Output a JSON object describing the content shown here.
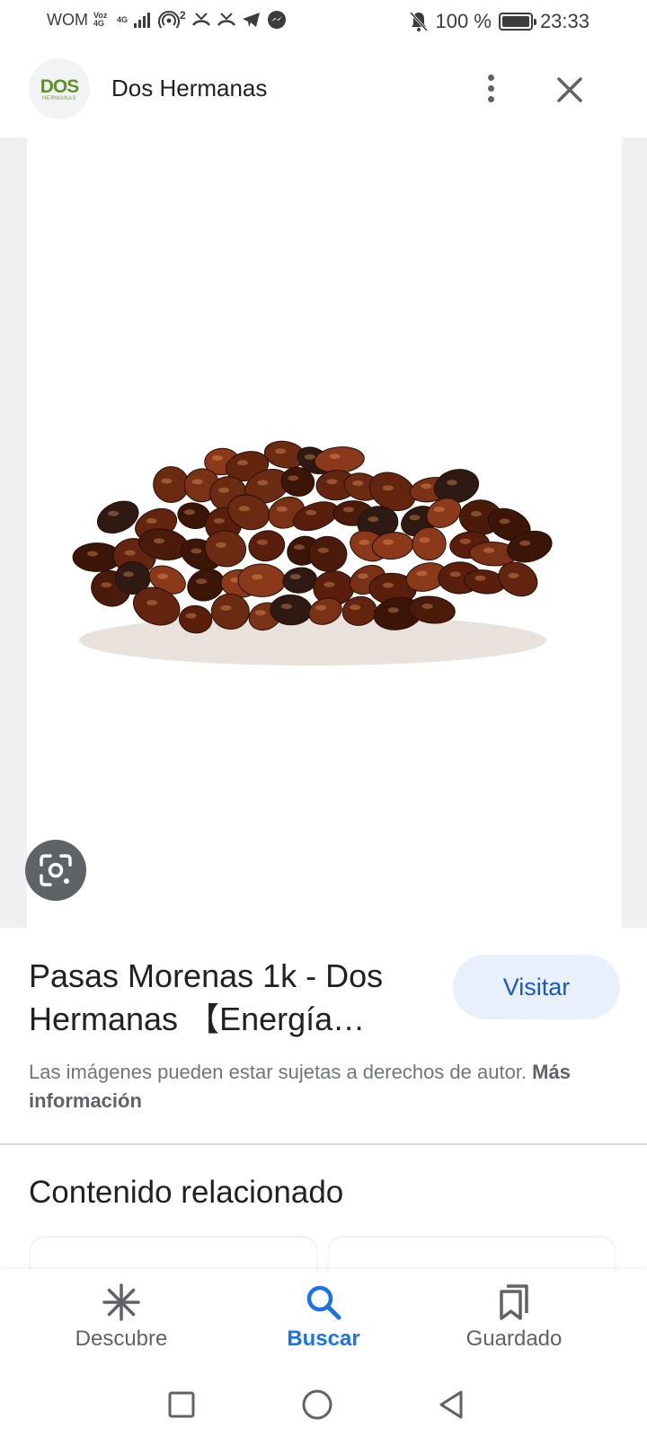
{
  "status_bar": {
    "carrier": "WOM",
    "volte": "Voz 4G",
    "network": "4G",
    "hotspot_count": "2",
    "battery_text": "100 %",
    "battery_level": 1.0,
    "time": "23:33"
  },
  "header": {
    "logo_text": "DOS",
    "logo_subtext": "HERMANAS",
    "site_name": "Dos Hermanas"
  },
  "result": {
    "title": "Pasas Morenas 1k - Dos Hermanas 【Energía…",
    "visit_label": "Visitar",
    "copyright_text": "Las imágenes pueden estar sujetas a derechos de autor.",
    "more_info_label": "Más información"
  },
  "related": {
    "heading": "Contenido relacionado"
  },
  "bottom_nav": {
    "items": [
      {
        "label": "Descubre",
        "icon": "asterisk-icon"
      },
      {
        "label": "Buscar",
        "icon": "search-icon",
        "active": true
      },
      {
        "label": "Guardado",
        "icon": "bookmarks-icon"
      }
    ]
  },
  "colors": {
    "accent": "#1a73e8",
    "visit_button_bg": "#e8f0fe",
    "raisin": "#6b2a12"
  }
}
